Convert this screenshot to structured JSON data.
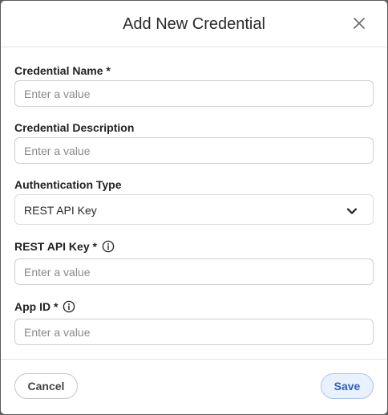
{
  "dialog": {
    "title": "Add New Credential",
    "close_icon": "close-icon"
  },
  "fields": {
    "credential_name": {
      "label": "Credential Name *",
      "placeholder": "Enter a value",
      "value": ""
    },
    "credential_description": {
      "label": "Credential Description",
      "placeholder": "Enter a value",
      "value": ""
    },
    "authentication_type": {
      "label": "Authentication Type",
      "selected": "REST API Key",
      "icon": "chevron-down-icon"
    },
    "rest_api_key": {
      "label": "REST API Key *",
      "placeholder": "Enter a value",
      "value": "",
      "icon": "info-icon"
    },
    "app_id": {
      "label": "App ID *",
      "placeholder": "Enter a value",
      "value": "",
      "icon": "info-icon"
    }
  },
  "footer": {
    "cancel_label": "Cancel",
    "save_label": "Save"
  },
  "colors": {
    "save_bg": "#e9f1fd",
    "save_text": "#2e62b8",
    "save_border": "#a9c4ee"
  }
}
